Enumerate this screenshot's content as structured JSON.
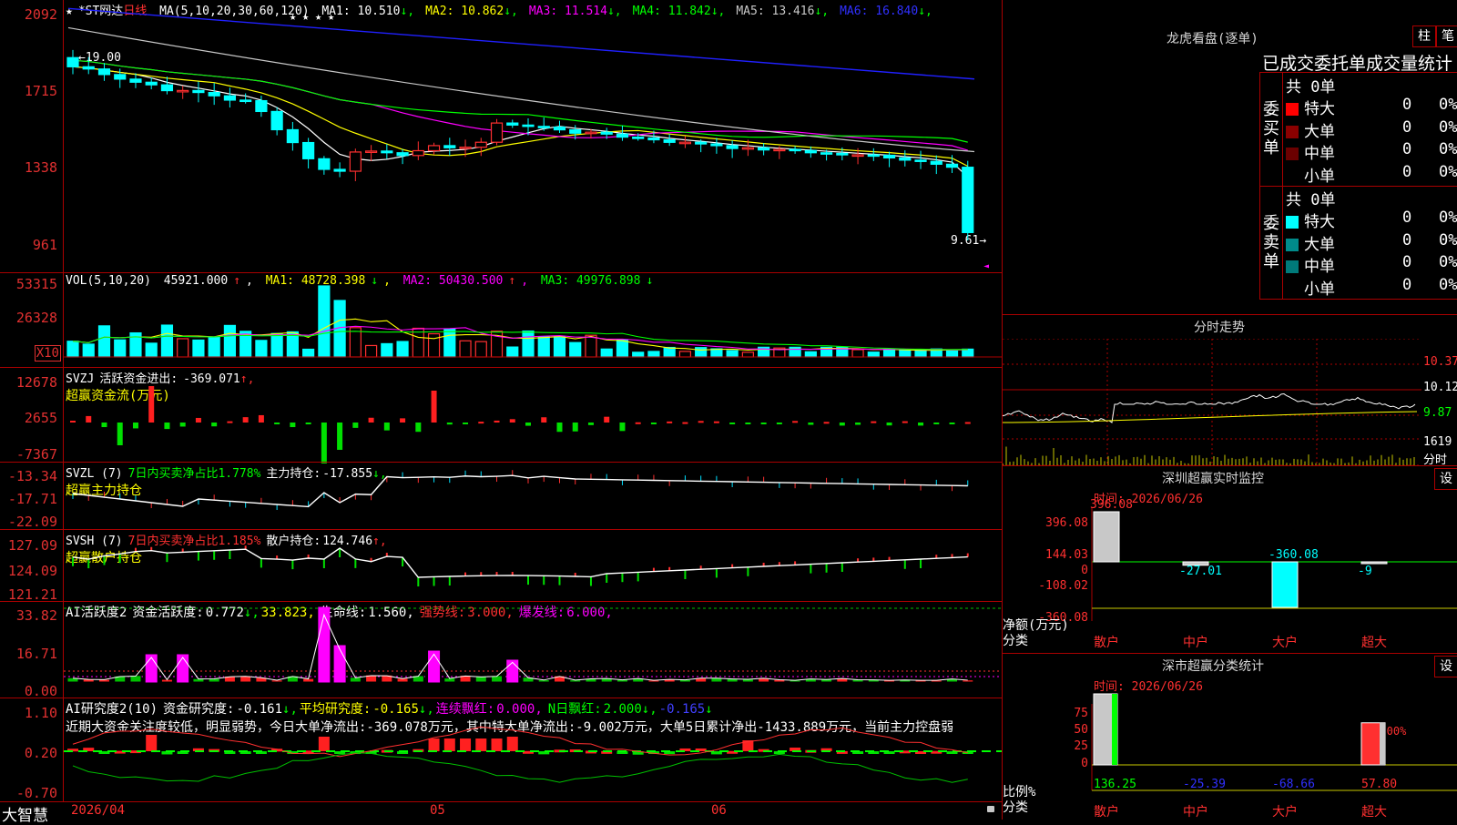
{
  "app": {
    "name": "大智慧"
  },
  "main": {
    "stock_name": "*ST网达",
    "period": "日线",
    "ma_label": "MA(5,10,20,30,60,120)",
    "ma_values": [
      {
        "label": "MA1:",
        "value": "10.510",
        "arrow": "↓",
        "color": "#ffffff"
      },
      {
        "label": "MA2:",
        "value": "10.862",
        "arrow": "↓",
        "color": "#ffff00"
      },
      {
        "label": "MA3:",
        "value": "11.514",
        "arrow": "↓",
        "color": "#ff00ff"
      },
      {
        "label": "MA4:",
        "value": "11.842",
        "arrow": "↓",
        "color": "#00ff00"
      },
      {
        "label": "MA5:",
        "value": "13.416",
        "arrow": "↓",
        "color": "#c8c8c8"
      },
      {
        "label": "MA6:",
        "value": "16.840",
        "arrow": "↓",
        "color": "#3030ff"
      }
    ],
    "y_ticks": [
      "2092",
      "1715",
      "1338",
      "961"
    ],
    "high_label": "19.00",
    "last_label": "9.61",
    "x_labels": [
      "2026/04",
      "05",
      "06"
    ]
  },
  "vol": {
    "label": "VOL(5,10,20)",
    "value": "45921.000",
    "value_arrow": "↑",
    "ma1": "48728.398",
    "ma1_arrow": "↓",
    "ma2": "50430.500",
    "ma2_arrow": "↑",
    "ma3": "49976.898",
    "ma3_arrow": "↓",
    "y_ticks": [
      "53315",
      "26328"
    ],
    "unit": "X10"
  },
  "svzj": {
    "label": "SVZJ",
    "desc": "活跃资金进出:",
    "value": "-369.071",
    "arrow": "↑,",
    "subtitle": "超赢资金流(万元)",
    "y_ticks": [
      "12678",
      "2655",
      "-7367"
    ]
  },
  "svzl": {
    "label": "SVZL (7)",
    "desc": "7日内买卖净占比1.778%",
    "hold": "主力持仓:",
    "value": "-17.855",
    "arrow": "↓,",
    "subtitle": "超赢主力持仓",
    "y_ticks": [
      "-13.34",
      "-17.71",
      "-22.09"
    ]
  },
  "svsh": {
    "label": "SVSH (7)",
    "desc": "7日内买卖净占比1.185%",
    "hold": "散户持仓:",
    "value": "124.746",
    "arrow": "↑,",
    "subtitle": "超赢散户持仓",
    "y_ticks": [
      "127.09",
      "124.09",
      "121.21"
    ]
  },
  "ai1": {
    "label": "AI活跃度2",
    "desc": "资金活跃度:",
    "value": "0.772",
    "arrow": "↓,",
    "v2": "33.823,",
    "life": "生命线:",
    "life_value": "1.560,",
    "strong": "强势线:",
    "strong_value": "3.000,",
    "burst": "爆发线:",
    "burst_value": "6.000,",
    "y_ticks": [
      "33.82",
      "16.71",
      "0.00"
    ]
  },
  "ai2": {
    "label": "AI研究度2(10)",
    "desc": "资金研究度:",
    "value": "-0.161",
    "arrow": "↓,",
    "avg": "平均研究度:",
    "avg_value": "-0.165",
    "avg_arrow": "↓,",
    "red": "连续飘红:",
    "red_value": "0.000,",
    "nred": "N日飘红:",
    "nred_value": "2.000",
    "nred_arrow": "↓,",
    "last": "-0.165",
    "last_arrow": "↓",
    "comment": "近期大资金关注度较低，明显弱势，今日大单净流出:-369.078万元，其中特大单净流出:-9.002万元，大单5日累计净出-1433.889万元，当前主力控盘弱",
    "y_ticks": [
      "1.10",
      "0.20",
      "-0.70"
    ]
  },
  "dragon": {
    "title": "龙虎看盘(逐单)",
    "btn1": "柱",
    "btn2": "笔",
    "subtitle": "已成交委托单成交量统计",
    "buy_label": "委买单",
    "sell_label": "委卖单",
    "buy_total": "共 0单",
    "sell_total": "共 0单",
    "buy_rows": [
      {
        "name": "特大",
        "count": "0",
        "pct": "0%",
        "color": "#ff0000"
      },
      {
        "name": "大单",
        "count": "0",
        "pct": "0%",
        "color": "#8b0000"
      },
      {
        "name": "中单",
        "count": "0",
        "pct": "0%",
        "color": "#6b0000"
      },
      {
        "name": "小单",
        "count": "0",
        "pct": "0%",
        "color": ""
      }
    ],
    "sell_rows": [
      {
        "name": "特大",
        "count": "0",
        "pct": "0%",
        "color": "#00ffff"
      },
      {
        "name": "大单",
        "count": "0",
        "pct": "0%",
        "color": "#008b8b"
      },
      {
        "name": "中单",
        "count": "0",
        "pct": "0%",
        "color": "#007a7a"
      },
      {
        "name": "小单",
        "count": "0",
        "pct": "0%",
        "color": ""
      }
    ]
  },
  "intraday": {
    "title": "分时走势",
    "y_ticks": [
      "10.37",
      "10.12",
      "9.87"
    ],
    "vol_tick": "1619",
    "footer": "分时"
  },
  "monitor": {
    "title": "深圳超赢实时监控",
    "btn": "设",
    "time": "时间: 2026/06/26",
    "y_ticks": [
      "396.08",
      "144.03",
      "0",
      "-108.02",
      "-360.08"
    ],
    "unit1": "净额(万元)",
    "unit2": "分类",
    "values": [
      "396.08",
      "-27.01",
      "-360.08",
      "-9"
    ],
    "categories": [
      "散户",
      "中户",
      "大户",
      "超大"
    ]
  },
  "classify": {
    "title": "深市超赢分类统计",
    "btn": "设",
    "time": "时间: 2026/06/26",
    "y_ticks": [
      "75",
      "50",
      "25",
      "0"
    ],
    "unit1": "比例%",
    "unit2": "分类",
    "top_label": "-0.00%",
    "values": [
      "136.25",
      "-25.39",
      "-68.66",
      "57.80"
    ],
    "categories": [
      "散户",
      "中户",
      "大户",
      "超大"
    ]
  }
}
